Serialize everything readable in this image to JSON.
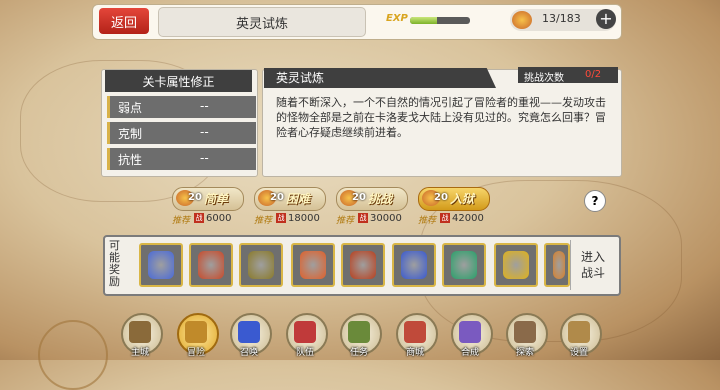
{
  "header": {
    "back_label": "返回",
    "title": "英灵试炼",
    "exp_label": "EXP",
    "exp_progress": 0.45,
    "stamina": "13/183",
    "plus": "+"
  },
  "modifiers": {
    "title": "关卡属性修正",
    "rows": [
      {
        "label": "弱点",
        "value": "--"
      },
      {
        "label": "克制",
        "value": "--"
      },
      {
        "label": "抗性",
        "value": "--"
      }
    ]
  },
  "description": {
    "tab_title": "英灵试炼",
    "challenge_label": "挑战次数",
    "challenge_count": "0/2",
    "text": "随着不断深入，一个不自然的情况引起了冒险者的重视——发动攻击的怪物全部是之前在卡洛麦戈大陆上没有见过的。究竟怎么回事？冒险者心存疑虑继续前进着。"
  },
  "difficulties": [
    {
      "cost": "20",
      "name": "简单",
      "recommend": "推荐",
      "badge": "战",
      "power": "6000"
    },
    {
      "cost": "20",
      "name": "困难",
      "recommend": "推荐",
      "badge": "战",
      "power": "18000"
    },
    {
      "cost": "20",
      "name": "挑战",
      "recommend": "推荐",
      "badge": "战",
      "power": "30000"
    },
    {
      "cost": "20",
      "name": "入狱",
      "recommend": "推荐",
      "badge": "战",
      "power": "42000"
    }
  ],
  "help": "?",
  "rewards": {
    "label": "可能奖励",
    "enter_line1": "进入",
    "enter_line2": "战斗",
    "items": [
      {
        "icon": "blue-crystal-icon",
        "color": "#4a6ad8"
      },
      {
        "icon": "red-ore-icon",
        "color": "#c84a2a"
      },
      {
        "icon": "gold-ore-icon",
        "color": "#8a7a2a"
      },
      {
        "icon": "fire-crystal-icon",
        "color": "#e0602a"
      },
      {
        "icon": "magma-ore-icon",
        "color": "#b8401e"
      },
      {
        "icon": "blue-weapon-icon",
        "color": "#3a5ad0"
      },
      {
        "icon": "green-gem-icon",
        "color": "#2aa06a"
      },
      {
        "icon": "gold-gem-icon",
        "color": "#e0b21a"
      },
      {
        "icon": "orange-gem-icon",
        "color": "#d8802a"
      }
    ]
  },
  "nav": [
    {
      "label": "主城",
      "icon": "castle-icon",
      "color": "#8a6a3a"
    },
    {
      "label": "冒险",
      "icon": "adventure-icon",
      "color": "#c08a2a"
    },
    {
      "label": "召唤",
      "icon": "summon-icon",
      "color": "#3a5ad0"
    },
    {
      "label": "队伍",
      "icon": "team-icon",
      "color": "#c03a3a"
    },
    {
      "label": "任务",
      "icon": "quest-icon",
      "color": "#6a8a3a"
    },
    {
      "label": "商城",
      "icon": "shop-icon",
      "color": "#c04a3a"
    },
    {
      "label": "合成",
      "icon": "craft-icon",
      "color": "#7a5ac0"
    },
    {
      "label": "探索",
      "icon": "explore-icon",
      "color": "#8a6a4a"
    },
    {
      "label": "设置",
      "icon": "settings-icon",
      "color": "#b08a4a"
    }
  ]
}
